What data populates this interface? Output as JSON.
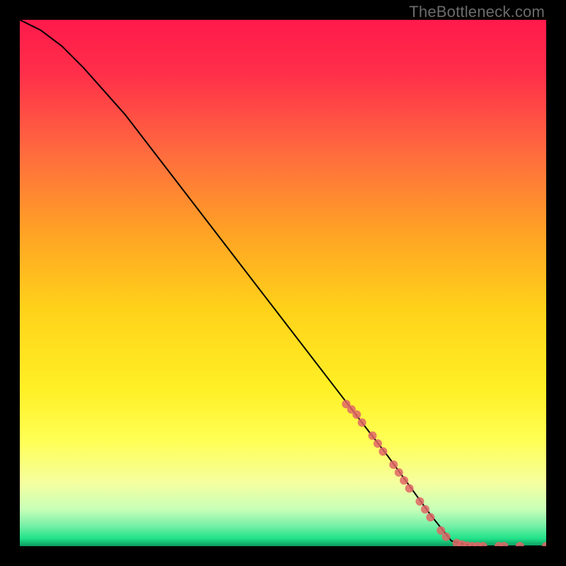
{
  "watermark": "TheBottleneck.com",
  "chart_data": {
    "type": "line",
    "title": "",
    "xlabel": "",
    "ylabel": "",
    "xlim": [
      0,
      100
    ],
    "ylim": [
      0,
      100
    ],
    "grid": false,
    "series": [
      {
        "name": "curve",
        "type": "line",
        "color": "#000000",
        "points": [
          {
            "x": 0,
            "y": 100
          },
          {
            "x": 4,
            "y": 98
          },
          {
            "x": 8,
            "y": 95
          },
          {
            "x": 12,
            "y": 91
          },
          {
            "x": 20,
            "y": 82
          },
          {
            "x": 30,
            "y": 69
          },
          {
            "x": 40,
            "y": 56
          },
          {
            "x": 50,
            "y": 43
          },
          {
            "x": 60,
            "y": 30
          },
          {
            "x": 70,
            "y": 17
          },
          {
            "x": 78,
            "y": 6
          },
          {
            "x": 82,
            "y": 1
          },
          {
            "x": 86,
            "y": 0
          },
          {
            "x": 100,
            "y": 0
          }
        ]
      },
      {
        "name": "highlighted-points",
        "type": "scatter",
        "color": "#e06666",
        "points": [
          {
            "x": 62,
            "y": 27
          },
          {
            "x": 63,
            "y": 26
          },
          {
            "x": 64,
            "y": 25
          },
          {
            "x": 65,
            "y": 23.5
          },
          {
            "x": 67,
            "y": 21
          },
          {
            "x": 68,
            "y": 19.5
          },
          {
            "x": 69,
            "y": 18
          },
          {
            "x": 71,
            "y": 15.5
          },
          {
            "x": 72,
            "y": 14
          },
          {
            "x": 73,
            "y": 12.5
          },
          {
            "x": 74,
            "y": 11
          },
          {
            "x": 76,
            "y": 8.5
          },
          {
            "x": 77,
            "y": 7
          },
          {
            "x": 78,
            "y": 5.5
          },
          {
            "x": 80,
            "y": 3
          },
          {
            "x": 81,
            "y": 1.8
          },
          {
            "x": 83,
            "y": 0.6
          },
          {
            "x": 84,
            "y": 0.3
          },
          {
            "x": 85,
            "y": 0.1
          },
          {
            "x": 86,
            "y": 0
          },
          {
            "x": 87,
            "y": 0
          },
          {
            "x": 88,
            "y": 0
          },
          {
            "x": 91,
            "y": 0
          },
          {
            "x": 92,
            "y": 0
          },
          {
            "x": 95,
            "y": 0
          },
          {
            "x": 100,
            "y": 0
          }
        ]
      }
    ],
    "gradient_stops": [
      {
        "offset": 0.0,
        "color": "#ff1a4b"
      },
      {
        "offset": 0.1,
        "color": "#ff2e4a"
      },
      {
        "offset": 0.25,
        "color": "#ff6a3f"
      },
      {
        "offset": 0.4,
        "color": "#ffa125"
      },
      {
        "offset": 0.55,
        "color": "#ffd21a"
      },
      {
        "offset": 0.7,
        "color": "#fff025"
      },
      {
        "offset": 0.8,
        "color": "#ffff55"
      },
      {
        "offset": 0.88,
        "color": "#f5ffa0"
      },
      {
        "offset": 0.93,
        "color": "#c8ffb8"
      },
      {
        "offset": 0.96,
        "color": "#7af0a8"
      },
      {
        "offset": 0.985,
        "color": "#22e38a"
      },
      {
        "offset": 1.0,
        "color": "#0a995f"
      }
    ]
  }
}
